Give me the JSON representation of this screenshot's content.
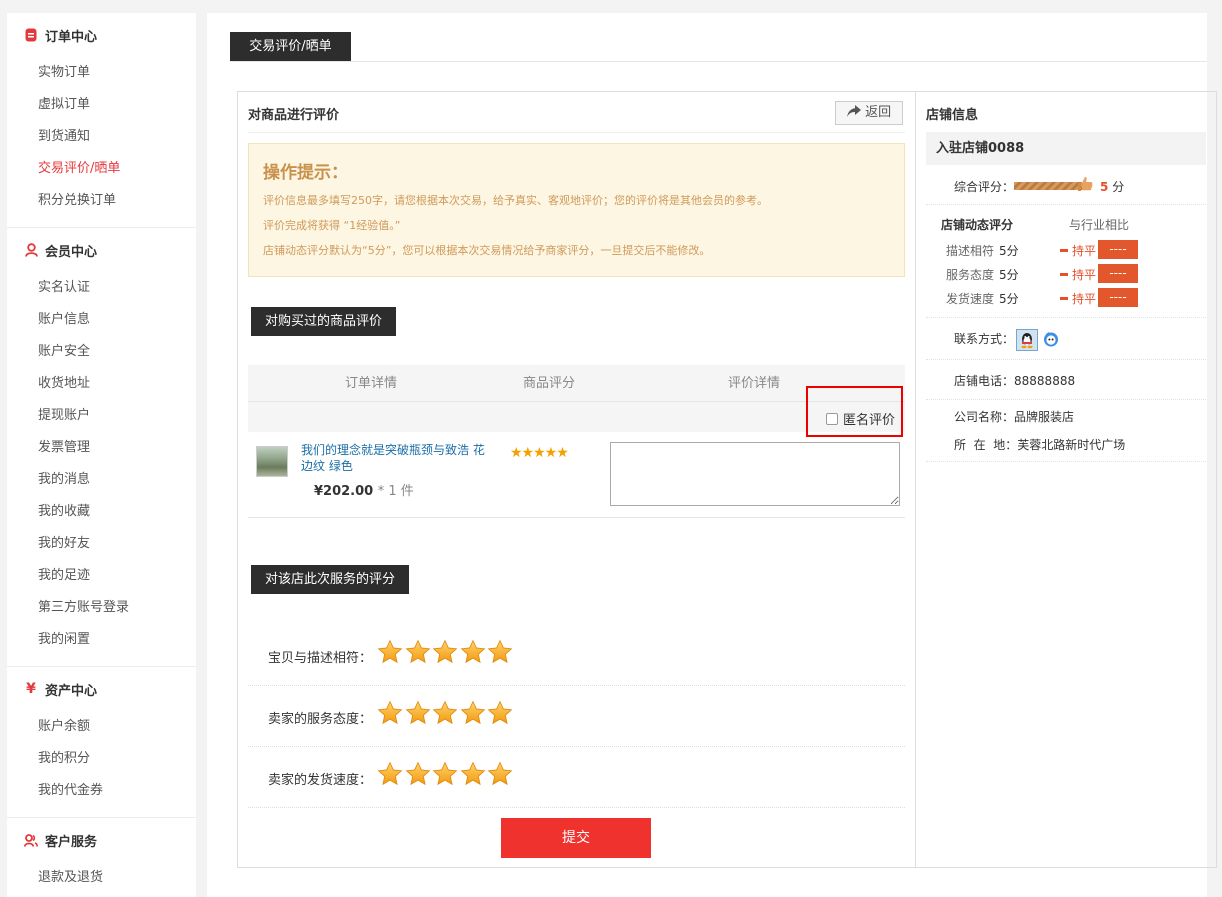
{
  "sidebar": {
    "groups": [
      {
        "title": "订单中心",
        "icon": "order-icon",
        "items": [
          "实物订单",
          "虚拟订单",
          "到货通知",
          "交易评价/晒单",
          "积分兑换订单"
        ],
        "active_index": 3
      },
      {
        "title": "会员中心",
        "icon": "user-icon",
        "items": [
          "实名认证",
          "账户信息",
          "账户安全",
          "收货地址",
          "提现账户",
          "发票管理",
          "我的消息",
          "我的收藏",
          "我的好友",
          "我的足迹",
          "第三方账号登录",
          "我的闲置"
        ]
      },
      {
        "title": "资产中心",
        "icon": "yen-icon",
        "items": [
          "账户余额",
          "我的积分",
          "我的代金券"
        ]
      },
      {
        "title": "客户服务",
        "icon": "service-icon",
        "items": [
          "退款及退货"
        ]
      }
    ]
  },
  "page": {
    "tab_title": "交易评价/晒单"
  },
  "review": {
    "title": "对商品进行评价",
    "back_label": "返回",
    "tip": {
      "title": "操作提示：",
      "lines": [
        "评价信息最多填写250字，请您根据本次交易，给予真实、客观地评价；您的评价将是其他会员的参考。",
        "评价完成将获得 “1经验值。”",
        "店铺动态评分默认为“5分”，您可以根据本次交易情况给予商家评分，一旦提交后不能修改。"
      ]
    },
    "goods_section_label": "对购买过的商品评价",
    "table_headers": [
      "订单详情",
      "商品评分",
      "评价详情"
    ],
    "anonymous_label": "匿名评价",
    "product": {
      "name": "我们的理念就是突破瓶颈与致浩 花边纹 绿色",
      "price": "¥202.00",
      "qty": "* 1 件",
      "rating": 5
    },
    "service_section_label": "对该店此次服务的评分",
    "service_ratings": [
      {
        "label": "宝贝与描述相符：",
        "stars": 5
      },
      {
        "label": "卖家的服务态度：",
        "stars": 5
      },
      {
        "label": "卖家的发货速度：",
        "stars": 5
      }
    ],
    "submit_label": "提交"
  },
  "store": {
    "title": "店铺信息",
    "name": "入驻店铺0088",
    "overall_label": "综合评分：",
    "overall_score": "5",
    "overall_unit": "分",
    "dynamic_label": "店铺动态评分",
    "compare_label": "与行业相比",
    "dynamic_rows": [
      {
        "label": "描述相符",
        "score": "5分",
        "trend": "持平",
        "badge": "----"
      },
      {
        "label": "服务态度",
        "score": "5分",
        "trend": "持平",
        "badge": "----"
      },
      {
        "label": "发货速度",
        "score": "5分",
        "trend": "持平",
        "badge": "----"
      }
    ],
    "contact_label": "联系方式：",
    "phone_label": "店铺电话：",
    "phone": "88888888",
    "company_label": "公司名称：",
    "company": "品牌服装店",
    "address_label": "所  在  地：",
    "address": "芙蓉北路新时代广场"
  },
  "colors": {
    "accent": "#e4393c",
    "submit": "#f0322f",
    "dark_tab": "#2d2d2d",
    "star": "#f4a100"
  }
}
